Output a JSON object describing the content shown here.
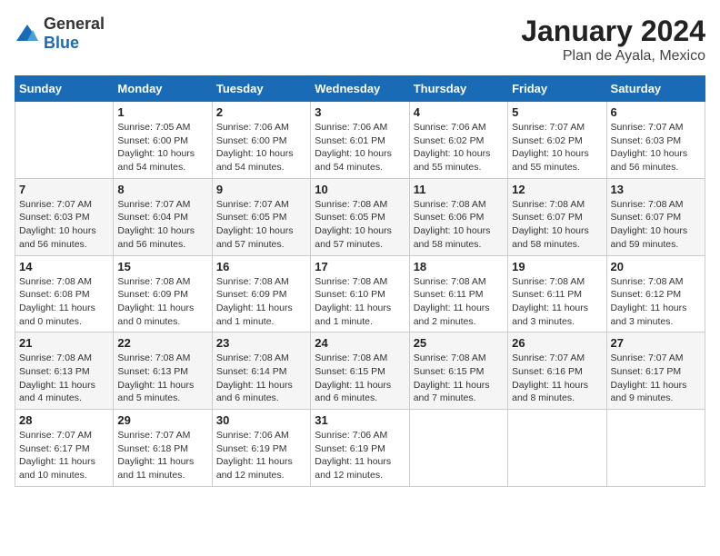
{
  "header": {
    "logo_general": "General",
    "logo_blue": "Blue",
    "title": "January 2024",
    "subtitle": "Plan de Ayala, Mexico"
  },
  "weekdays": [
    "Sunday",
    "Monday",
    "Tuesday",
    "Wednesday",
    "Thursday",
    "Friday",
    "Saturday"
  ],
  "weeks": [
    [
      {
        "day": "",
        "info": ""
      },
      {
        "day": "1",
        "info": "Sunrise: 7:05 AM\nSunset: 6:00 PM\nDaylight: 10 hours\nand 54 minutes."
      },
      {
        "day": "2",
        "info": "Sunrise: 7:06 AM\nSunset: 6:00 PM\nDaylight: 10 hours\nand 54 minutes."
      },
      {
        "day": "3",
        "info": "Sunrise: 7:06 AM\nSunset: 6:01 PM\nDaylight: 10 hours\nand 54 minutes."
      },
      {
        "day": "4",
        "info": "Sunrise: 7:06 AM\nSunset: 6:02 PM\nDaylight: 10 hours\nand 55 minutes."
      },
      {
        "day": "5",
        "info": "Sunrise: 7:07 AM\nSunset: 6:02 PM\nDaylight: 10 hours\nand 55 minutes."
      },
      {
        "day": "6",
        "info": "Sunrise: 7:07 AM\nSunset: 6:03 PM\nDaylight: 10 hours\nand 56 minutes."
      }
    ],
    [
      {
        "day": "7",
        "info": "Sunrise: 7:07 AM\nSunset: 6:03 PM\nDaylight: 10 hours\nand 56 minutes."
      },
      {
        "day": "8",
        "info": "Sunrise: 7:07 AM\nSunset: 6:04 PM\nDaylight: 10 hours\nand 56 minutes."
      },
      {
        "day": "9",
        "info": "Sunrise: 7:07 AM\nSunset: 6:05 PM\nDaylight: 10 hours\nand 57 minutes."
      },
      {
        "day": "10",
        "info": "Sunrise: 7:08 AM\nSunset: 6:05 PM\nDaylight: 10 hours\nand 57 minutes."
      },
      {
        "day": "11",
        "info": "Sunrise: 7:08 AM\nSunset: 6:06 PM\nDaylight: 10 hours\nand 58 minutes."
      },
      {
        "day": "12",
        "info": "Sunrise: 7:08 AM\nSunset: 6:07 PM\nDaylight: 10 hours\nand 58 minutes."
      },
      {
        "day": "13",
        "info": "Sunrise: 7:08 AM\nSunset: 6:07 PM\nDaylight: 10 hours\nand 59 minutes."
      }
    ],
    [
      {
        "day": "14",
        "info": "Sunrise: 7:08 AM\nSunset: 6:08 PM\nDaylight: 11 hours\nand 0 minutes."
      },
      {
        "day": "15",
        "info": "Sunrise: 7:08 AM\nSunset: 6:09 PM\nDaylight: 11 hours\nand 0 minutes."
      },
      {
        "day": "16",
        "info": "Sunrise: 7:08 AM\nSunset: 6:09 PM\nDaylight: 11 hours\nand 1 minute."
      },
      {
        "day": "17",
        "info": "Sunrise: 7:08 AM\nSunset: 6:10 PM\nDaylight: 11 hours\nand 1 minute."
      },
      {
        "day": "18",
        "info": "Sunrise: 7:08 AM\nSunset: 6:11 PM\nDaylight: 11 hours\nand 2 minutes."
      },
      {
        "day": "19",
        "info": "Sunrise: 7:08 AM\nSunset: 6:11 PM\nDaylight: 11 hours\nand 3 minutes."
      },
      {
        "day": "20",
        "info": "Sunrise: 7:08 AM\nSunset: 6:12 PM\nDaylight: 11 hours\nand 3 minutes."
      }
    ],
    [
      {
        "day": "21",
        "info": "Sunrise: 7:08 AM\nSunset: 6:13 PM\nDaylight: 11 hours\nand 4 minutes."
      },
      {
        "day": "22",
        "info": "Sunrise: 7:08 AM\nSunset: 6:13 PM\nDaylight: 11 hours\nand 5 minutes."
      },
      {
        "day": "23",
        "info": "Sunrise: 7:08 AM\nSunset: 6:14 PM\nDaylight: 11 hours\nand 6 minutes."
      },
      {
        "day": "24",
        "info": "Sunrise: 7:08 AM\nSunset: 6:15 PM\nDaylight: 11 hours\nand 6 minutes."
      },
      {
        "day": "25",
        "info": "Sunrise: 7:08 AM\nSunset: 6:15 PM\nDaylight: 11 hours\nand 7 minutes."
      },
      {
        "day": "26",
        "info": "Sunrise: 7:07 AM\nSunset: 6:16 PM\nDaylight: 11 hours\nand 8 minutes."
      },
      {
        "day": "27",
        "info": "Sunrise: 7:07 AM\nSunset: 6:17 PM\nDaylight: 11 hours\nand 9 minutes."
      }
    ],
    [
      {
        "day": "28",
        "info": "Sunrise: 7:07 AM\nSunset: 6:17 PM\nDaylight: 11 hours\nand 10 minutes."
      },
      {
        "day": "29",
        "info": "Sunrise: 7:07 AM\nSunset: 6:18 PM\nDaylight: 11 hours\nand 11 minutes."
      },
      {
        "day": "30",
        "info": "Sunrise: 7:06 AM\nSunset: 6:19 PM\nDaylight: 11 hours\nand 12 minutes."
      },
      {
        "day": "31",
        "info": "Sunrise: 7:06 AM\nSunset: 6:19 PM\nDaylight: 11 hours\nand 12 minutes."
      },
      {
        "day": "",
        "info": ""
      },
      {
        "day": "",
        "info": ""
      },
      {
        "day": "",
        "info": ""
      }
    ]
  ]
}
